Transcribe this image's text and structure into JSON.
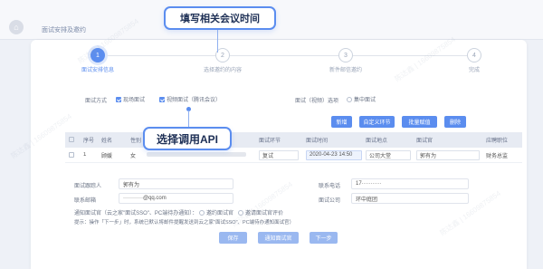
{
  "breadcrumb": "面试安排及邀约",
  "callouts": {
    "top": "填写相关会议时间",
    "middle": "选择调用API"
  },
  "steps": [
    {
      "num": "1",
      "label": "面试安排信息"
    },
    {
      "num": "2",
      "label": "选择邀约的内容"
    },
    {
      "num": "3",
      "label": "新件邮信邀约"
    },
    {
      "num": "4",
      "label": "完成"
    }
  ],
  "form": {
    "method_label": "面试方式",
    "method_opt1": "现场面试",
    "method_opt2": "视频面试（腾讯会议）",
    "video_label": "面试（视频）选项",
    "video_opt": "集中面试"
  },
  "actions": [
    "新增",
    "自定义环节",
    "批量赋值",
    "删除"
  ],
  "table": {
    "headers": [
      "",
      "序号",
      "姓名",
      "性别",
      "",
      "面试环节",
      "面试时间",
      "面试地点",
      "面试官",
      "应聘职位"
    ],
    "row": {
      "index": "1",
      "name": "顾媛",
      "gender": "女",
      "stage": "复试",
      "time": "2020-04-23 14:50",
      "place": "公司大堂",
      "interviewer": "郭有为",
      "position": "财务总监"
    }
  },
  "contact": {
    "arranger_label": "面试跟踪人",
    "arranger_value": "郭有为",
    "email_label": "联系邮箱",
    "email_value": "···········@qq.com",
    "phone_label": "联系电话",
    "phone_value": "17···········",
    "company_label": "面试公司",
    "company_value": "环中庭团"
  },
  "notify": {
    "line1": "通知面试官（云之家\"面试SSO\"、PC端待办通知）：",
    "opt1": "邀约面试官",
    "opt2": "邀请面试官评价",
    "line2": "提示：操作「下一步」时，系统已默认将邮件提醒发送到云之家\"面试SSO\"、PC端待办通知面试官）"
  },
  "footer": [
    "保存",
    "通知面试官",
    "下一步"
  ],
  "watermark": "陈达鑫 | 16609875854"
}
